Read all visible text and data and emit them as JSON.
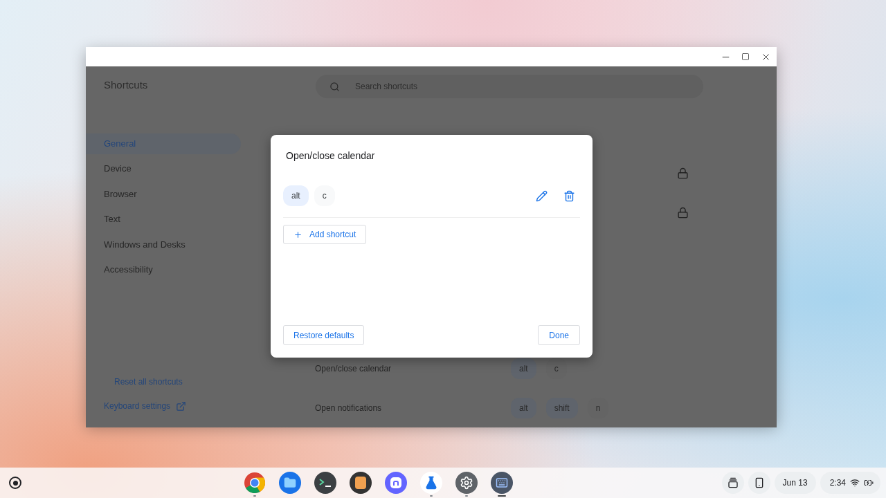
{
  "window": {
    "title_bar_buttons": [
      {
        "kind": "minimize"
      },
      {
        "kind": "maximize"
      },
      {
        "kind": "close"
      }
    ]
  },
  "sidebar": {
    "title": "Shortcuts",
    "items": [
      {
        "label": "General",
        "selected": true
      },
      {
        "label": "Device",
        "selected": false
      },
      {
        "label": "Browser",
        "selected": false
      },
      {
        "label": "Text",
        "selected": false
      },
      {
        "label": "Windows and Desks",
        "selected": false
      },
      {
        "label": "Accessibility",
        "selected": false
      }
    ],
    "reset_link": "Reset all shortcuts",
    "settings_link": "Keyboard settings"
  },
  "search": {
    "placeholder": "Search shortcuts"
  },
  "rows": [
    {
      "locked": true
    },
    {
      "locked": true
    },
    {
      "label": "Open/close calendar",
      "keys": [
        {
          "label": "alt",
          "kind": "modifier"
        },
        {
          "label": "c",
          "kind": "key"
        }
      ],
      "locked": false
    },
    {
      "label": "Open notifications",
      "keys": [
        {
          "label": "alt",
          "kind": "modifier"
        },
        {
          "label": "shift",
          "kind": "modifier"
        },
        {
          "label": "n",
          "kind": "key"
        }
      ],
      "locked": false
    }
  ],
  "dialog": {
    "title": "Open/close calendar",
    "keys": [
      {
        "label": "alt",
        "kind": "modifier"
      },
      {
        "label": "c",
        "kind": "key"
      }
    ],
    "add_button": "Add shortcut",
    "restore_button": "Restore defaults",
    "done_button": "Done"
  },
  "shelf": {
    "apps": [
      {
        "kind": "chrome",
        "open": true,
        "active": false
      },
      {
        "kind": "files",
        "open": false,
        "active": false
      },
      {
        "kind": "terminal",
        "open": false,
        "active": false
      },
      {
        "kind": "photos",
        "open": false,
        "active": false
      },
      {
        "kind": "mastodon",
        "open": false,
        "active": false
      },
      {
        "kind": "flask",
        "open": true,
        "active": false
      },
      {
        "kind": "settings",
        "open": true,
        "active": false
      },
      {
        "kind": "keyboard",
        "open": true,
        "active": true
      }
    ],
    "date": "Jun 13",
    "time": "2:34"
  }
}
